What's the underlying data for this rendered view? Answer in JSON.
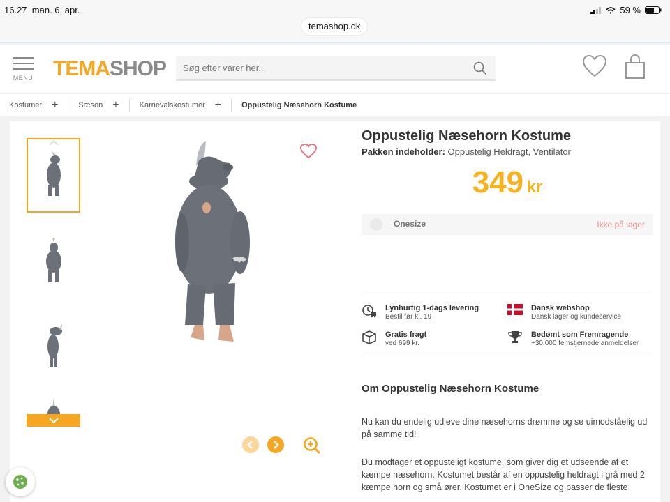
{
  "status": {
    "time": "16.27",
    "date": "man. 6. apr.",
    "battery": "59 %"
  },
  "browser": {
    "url": "temashop.dk"
  },
  "header": {
    "menu_label": "MENU",
    "logo_part1": "TEMA",
    "logo_part2": "SHOP",
    "search_placeholder": "Søg efter varer her...",
    "icons": [
      "hamburger-icon",
      "search-icon",
      "heart-icon",
      "shopping-bag-icon"
    ]
  },
  "breadcrumb": [
    {
      "label": "Kostumer"
    },
    {
      "label": "Sæson"
    },
    {
      "label": "Karnevalskostumer"
    },
    {
      "label": "Oppustelig Næsehorn Kostume"
    }
  ],
  "product": {
    "title": "Oppustelig Næsehorn Kostume",
    "contains_label": "Pakken indeholder:",
    "contains_value": "Oppustelig Heldragt, Ventilator",
    "price": "349",
    "currency": "kr",
    "size_name": "Onesize",
    "size_stock": "Ikke på lager"
  },
  "usps": [
    {
      "title": "Lynhurtig 1-dags levering",
      "sub": "Bestil før kl. 19",
      "icon": "clock-truck-icon"
    },
    {
      "title": "Dansk webshop",
      "sub": "Dansk lager og kundeservice",
      "icon": "danish-flag-icon"
    },
    {
      "title": "Gratis fragt",
      "sub": "ved 699 kr.",
      "icon": "package-icon"
    },
    {
      "title": "Bedømt som Fremragende",
      "sub": "+30.000 femstjernede anmeldelser",
      "icon": "trophy-icon"
    }
  ],
  "about": {
    "heading": "Om Oppustelig Næsehorn Kostume",
    "p1": "Nu kan du endelig udleve dine næsehorns drømme og se uimodståelig ud på samme tid!",
    "p2": "Du modtager et oppusteligt kostume, som giver dig et udseende af et kæmpe næsehorn. Kostumet består af en oppustelig heldragt i grå med 2 kæmpe horn og små ører. Kostumet er i OneSize og passer de fleste"
  },
  "colors": {
    "accent": "#f5a623",
    "price": "#f5b323",
    "stock": "#e08b8b"
  }
}
